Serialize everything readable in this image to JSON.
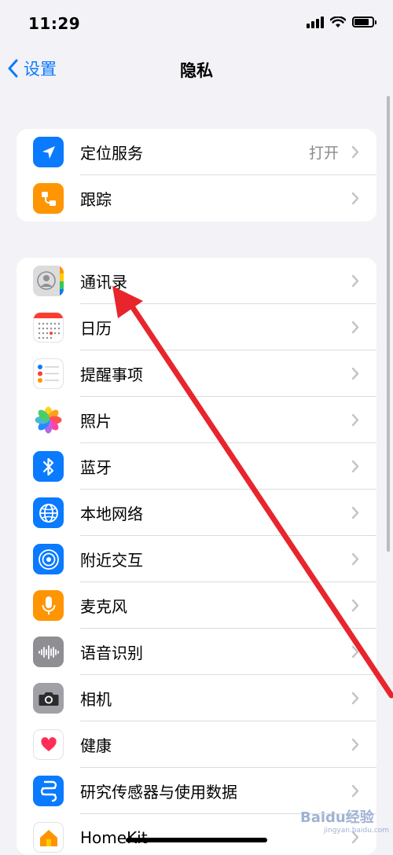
{
  "status_bar": {
    "time": "11:29"
  },
  "nav": {
    "back_label": "设置",
    "title": "隐私"
  },
  "group1": [
    {
      "label": "定位服务",
      "value": "打开",
      "icon": "location-arrow-icon",
      "color": "#0a7aff"
    },
    {
      "label": "跟踪",
      "icon": "tracking-icon",
      "color": "#ff9500"
    }
  ],
  "group2": [
    {
      "label": "通讯录",
      "icon": "contacts-icon"
    },
    {
      "label": "日历",
      "icon": "calendar-icon"
    },
    {
      "label": "提醒事项",
      "icon": "reminders-icon"
    },
    {
      "label": "照片",
      "icon": "photos-icon"
    },
    {
      "label": "蓝牙",
      "icon": "bluetooth-icon",
      "color": "#0a7aff"
    },
    {
      "label": "本地网络",
      "icon": "globe-icon",
      "color": "#0a7aff"
    },
    {
      "label": "附近交互",
      "icon": "nearby-interaction-icon",
      "color": "#0a7aff"
    },
    {
      "label": "麦克风",
      "icon": "microphone-icon",
      "color": "#ff9500"
    },
    {
      "label": "语音识别",
      "icon": "waveform-icon",
      "color": "#8e8e93"
    },
    {
      "label": "相机",
      "icon": "camera-icon",
      "color": "#8e8e93"
    },
    {
      "label": "健康",
      "icon": "heart-icon"
    },
    {
      "label": "研究传感器与使用数据",
      "icon": "research-icon",
      "color": "#0a7aff"
    },
    {
      "label": "HomeKit",
      "icon": "home-icon",
      "color": "#ff9500"
    }
  ],
  "watermark": {
    "brand": "Baidu经验",
    "url": "jingyan.baidu.com"
  },
  "annotation_color": "#e8242c"
}
